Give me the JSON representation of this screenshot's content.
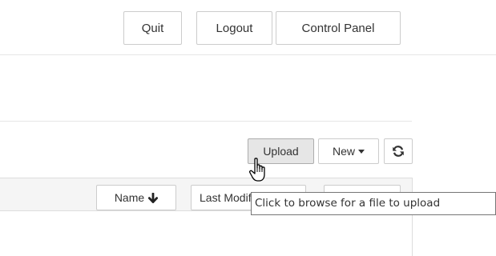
{
  "header": {
    "quit_label": "Quit",
    "logout_label": "Logout",
    "control_panel_label": "Control Panel"
  },
  "toolbar": {
    "upload_label": "Upload",
    "new_label": "New",
    "new_caret_icon": "caret-down-icon",
    "refresh_icon": "refresh-icon"
  },
  "list_header": {
    "name_label": "Name",
    "name_sort_icon": "arrow-down-icon",
    "last_modified_label": "Last Modified"
  },
  "tooltip": {
    "text": "Click to browse for a file to upload"
  },
  "cursor": {
    "icon": "hand-pointer-icon"
  }
}
